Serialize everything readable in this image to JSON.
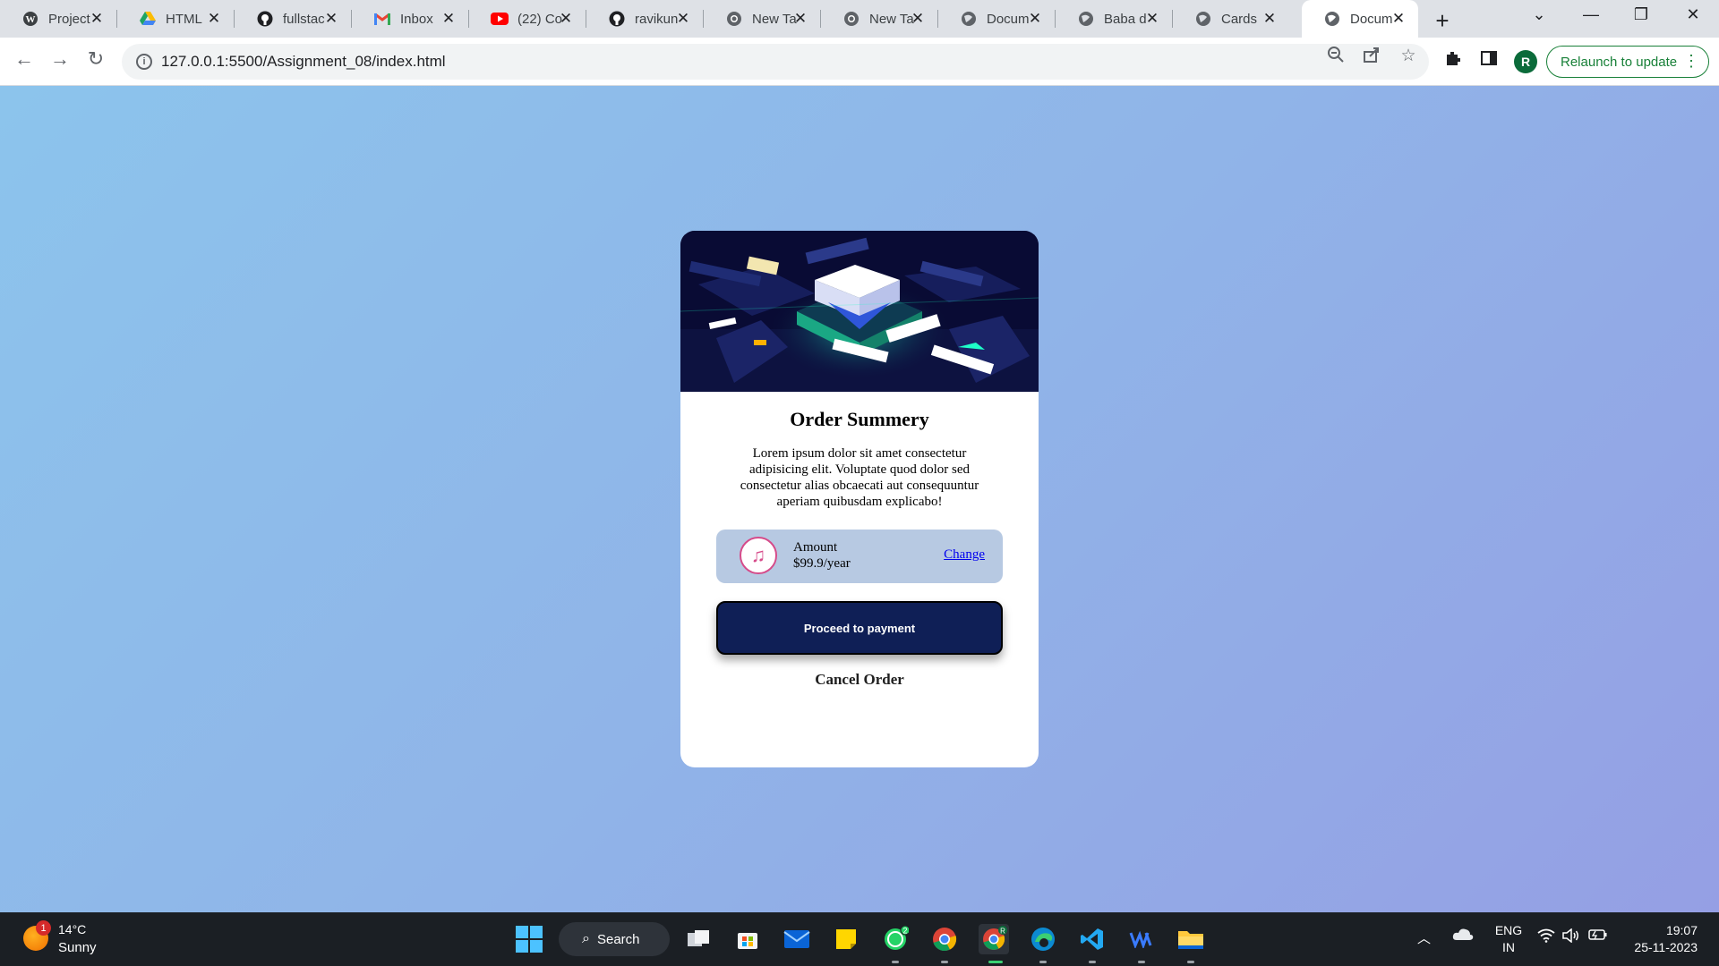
{
  "browser": {
    "tabs": [
      {
        "title": "Project",
        "icon": "wordpress-icon",
        "active": false
      },
      {
        "title": "HTML",
        "icon": "google-drive-icon",
        "active": false
      },
      {
        "title": "fullstac",
        "icon": "github-icon",
        "active": false
      },
      {
        "title": "Inbox",
        "icon": "gmail-icon",
        "active": false
      },
      {
        "title": "(22) Co",
        "icon": "youtube-icon",
        "active": false
      },
      {
        "title": "ravikun",
        "icon": "github-icon",
        "active": false
      },
      {
        "title": "New Ta",
        "icon": "chrome-icon",
        "active": false
      },
      {
        "title": "New Ta",
        "icon": "chrome-icon",
        "active": false
      },
      {
        "title": "Docum",
        "icon": "globe-icon",
        "active": false
      },
      {
        "title": "Baba d",
        "icon": "globe-icon",
        "active": false
      },
      {
        "title": "Cards",
        "icon": "globe-icon",
        "active": false
      },
      {
        "title": "Docum",
        "icon": "globe-icon",
        "active": true
      }
    ],
    "url": {
      "host": "127.0.0.1",
      "path": ":5500/Assignment_08/index.html"
    },
    "profile_initial": "R",
    "relaunch_label": "Relaunch to update"
  },
  "card": {
    "title": "Order Summery",
    "description": "Lorem ipsum dolor sit amet consectetur adipisicing elit. Voluptate quod dolor sed consectetur alias obcaecati aut consequuntur aperiam quibusdam explicabo!",
    "plan": {
      "label": "Amount",
      "price": "$99.9/year",
      "change_link": "Change",
      "icon": "music-note-icon"
    },
    "pay_button": "Proceed to payment",
    "cancel": "Cancel Order"
  },
  "taskbar": {
    "weather": {
      "temp": "14°C",
      "desc": "Sunny",
      "badge": "1"
    },
    "search_label": "Search",
    "whatsapp_badge": "2",
    "chrome_profile_badge": "R",
    "language": {
      "line1": "ENG",
      "line2": "IN"
    },
    "clock": {
      "time": "19:07",
      "date": "25-11-2023"
    }
  },
  "colors": {
    "page_gradient_start": "#8cc4ec",
    "page_gradient_end": "#959fe4",
    "pay_button": "#0f1f56",
    "plan_box": "#b7c9e2",
    "relaunch": "#188038"
  }
}
